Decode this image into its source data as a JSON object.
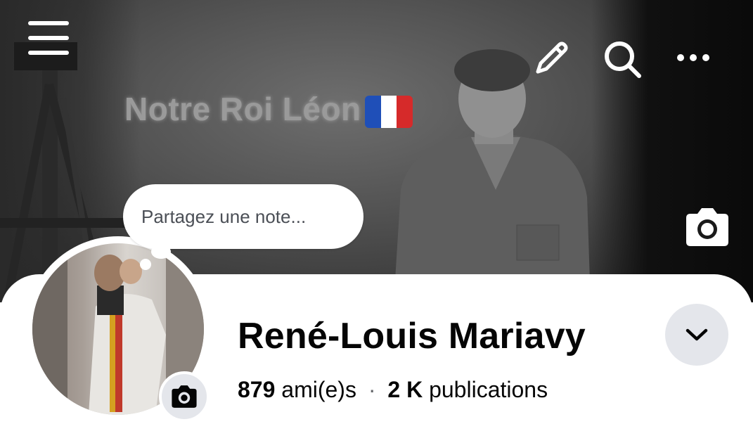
{
  "cover": {
    "title": "Notre Roi Léon",
    "flag_colors": [
      "#1f4fb8",
      "#ffffff",
      "#d62a2a"
    ]
  },
  "toolbar": {
    "menu_icon": "hamburger-menu-icon",
    "edit_icon": "pencil-icon",
    "search_icon": "search-icon",
    "more_icon": "more-horizontal-icon"
  },
  "note": {
    "placeholder": "Partagez une note..."
  },
  "profile": {
    "name": "René-Louis Mariavy",
    "friends_count": "879",
    "friends_label": "ami(e)s",
    "separator": "·",
    "posts_count": "2 K",
    "posts_label": "publications"
  },
  "colors": {
    "button_bg": "#e4e6eb",
    "text_primary": "#050505"
  }
}
